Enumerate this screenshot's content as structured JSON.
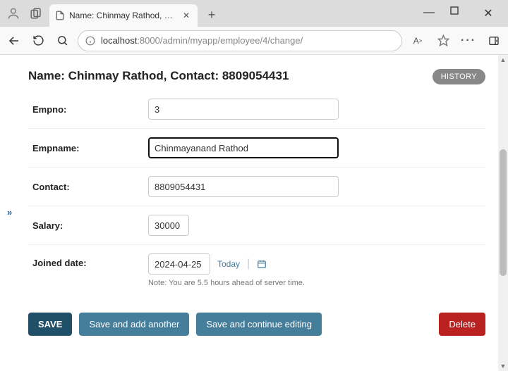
{
  "browser": {
    "tab_title": "Name: Chinmay Rathod, Contact:",
    "url_host": "localhost",
    "url_rest": ":8000/admin/myapp/employee/4/change/"
  },
  "header": {
    "object_title": "Name: Chinmay Rathod, Contact: 8809054431",
    "history_label": "HISTORY"
  },
  "form": {
    "empno": {
      "label": "Empno:",
      "value": "3"
    },
    "empname": {
      "label": "Empname:",
      "value": "Chinmayanand Rathod"
    },
    "contact": {
      "label": "Contact:",
      "value": "8809054431"
    },
    "salary": {
      "label": "Salary:",
      "value": "30000"
    },
    "joined_date": {
      "label": "Joined date:",
      "value": "2024-04-25",
      "today_label": "Today",
      "help_text": "Note: You are 5.5 hours ahead of server time."
    }
  },
  "actions": {
    "save": "SAVE",
    "save_add": "Save and add another",
    "save_continue": "Save and continue editing",
    "delete": "Delete"
  }
}
